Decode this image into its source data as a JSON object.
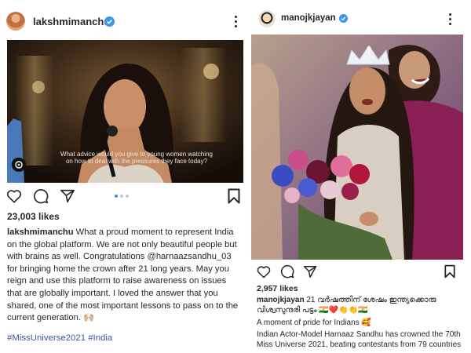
{
  "colors": {
    "accent": "#3897f0",
    "text": "#262626",
    "hashtag": "#385898"
  },
  "post1": {
    "username": "lakshmimanchu",
    "avatar_icon": "profile-photo",
    "verified_icon": "verified-badge",
    "video": {
      "subtitle_line1": "What advice would you give to young women watching",
      "subtitle_line2": "on how to deal with the pressures they face today?",
      "audio_icon": "audio-toggle"
    },
    "carousel": {
      "count": 3,
      "active": 1
    },
    "likes": "23,003 likes",
    "caption": {
      "username": "lakshmimanchu",
      "lines": [
        " What a proud moment to represent India",
        "on the global platform. We are not only beautiful people but",
        "with brains as well. Congratulations @harnaazsandhu_03",
        "for bringing home the crown after 21 long years. May you",
        "reign and use this platform to raise awareness on issues",
        "that are globally important. I loved the answer that you",
        "shared, one of the most important lessons to pass on to the",
        "current generation. 🙌🏼"
      ]
    },
    "hashtags": "#MissUniverse2021 #India"
  },
  "post2": {
    "username": "manojkjayan",
    "avatar_icon": "profile-photo",
    "verified_icon": "verified-badge",
    "likes": "2,957 likes",
    "caption": {
      "username": "manojkjayan",
      "line1": " 21 വർഷത്തിന് ശേഷം ഇന്ത്യക്കൊരു",
      "line2": "വിശ്വസുന്ദരി പട്ടം 🇮🇳❤️👏👏🇮🇳",
      "line3": "A moment of pride for Indians 🥰",
      "line4": "Indian Actor-Model Harnaaz Sandhu has crowned the 70th",
      "line5": "Miss Universe 2021, beating contestants from 79 countries"
    }
  }
}
